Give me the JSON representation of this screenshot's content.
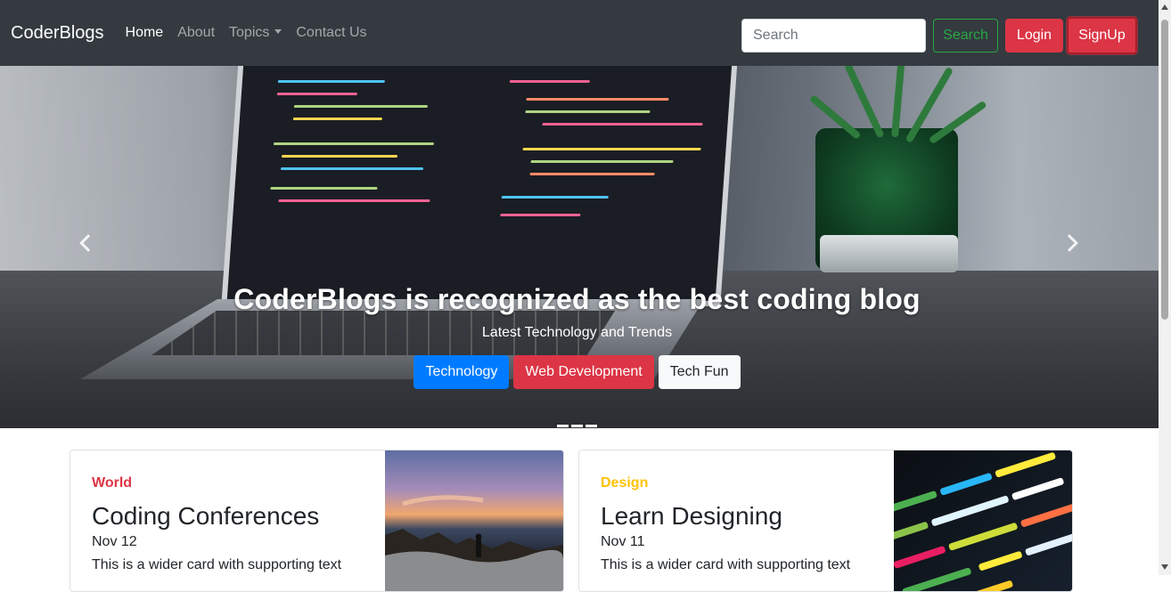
{
  "navbar": {
    "brand": "CoderBlogs",
    "links": [
      {
        "label": "Home",
        "active": true
      },
      {
        "label": "About",
        "active": false
      },
      {
        "label": "Topics",
        "active": false,
        "dropdown": true
      },
      {
        "label": "Contact Us",
        "active": false
      }
    ],
    "search_placeholder": "Search",
    "search_button": "Search",
    "login_button": "Login",
    "signup_button": "SignUp"
  },
  "carousel": {
    "title": "CoderBlogs is recognized as the best coding blog",
    "subtitle": "Latest Technology and Trends",
    "buttons": [
      "Technology",
      "Web Development",
      "Tech Fun"
    ],
    "prev_icon": "chevron-left-icon",
    "next_icon": "chevron-right-icon",
    "indicator_count": 3
  },
  "cards": [
    {
      "category": "World",
      "title": "Coding Conferences",
      "date": "Nov 12",
      "text": "This is a wider card with supporting text"
    },
    {
      "category": "Design",
      "title": "Learn Designing",
      "date": "Nov 11",
      "text": "This is a wider card with supporting text"
    }
  ],
  "colors": {
    "navbar_bg": "#343a40",
    "primary": "#007bff",
    "danger": "#dc3545",
    "success": "#28a745",
    "warning": "#ffc107"
  }
}
